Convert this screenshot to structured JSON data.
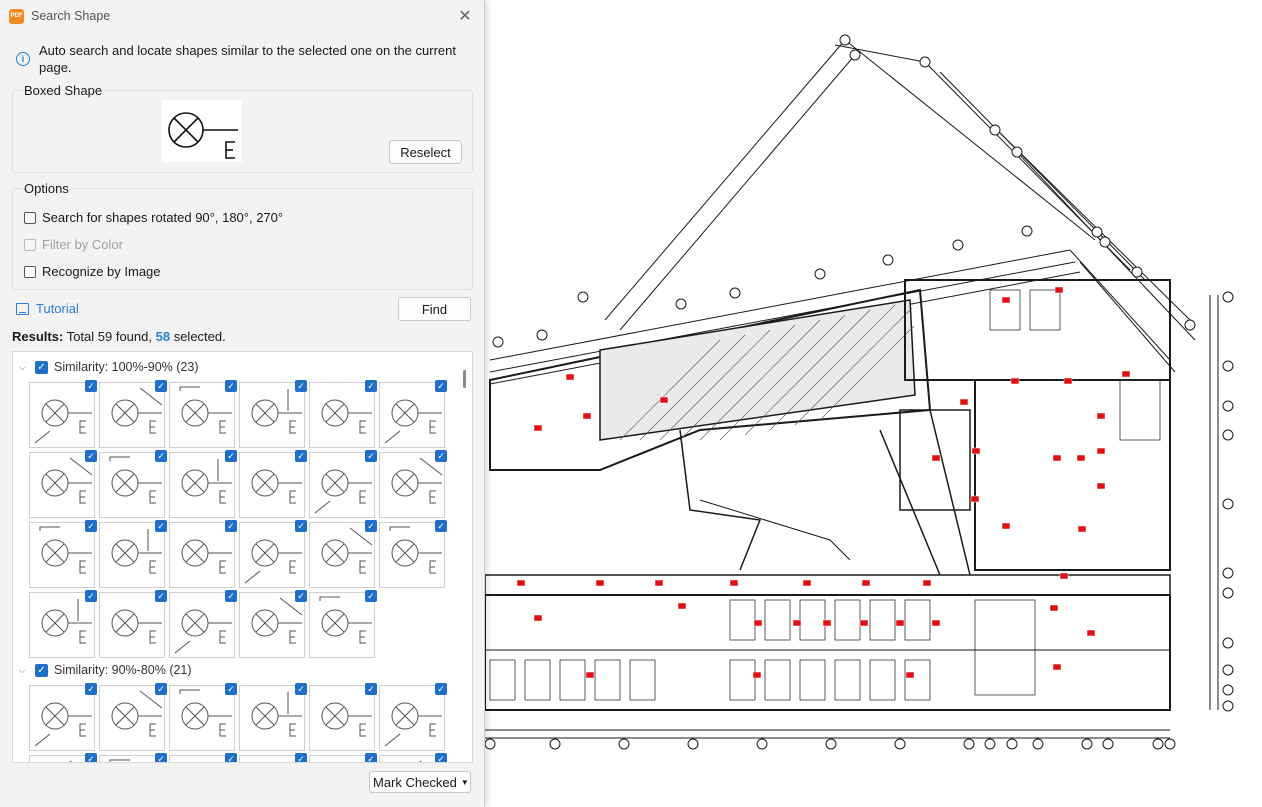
{
  "window": {
    "title": "Search Shape",
    "app_icon": "PDF",
    "close_glyph": "✕"
  },
  "info": {
    "text": "Auto search and locate shapes similar to the selected one on the current page.",
    "icon": "info-icon"
  },
  "boxed_shape": {
    "label": "Boxed Shape",
    "reselect_label": "Reselect"
  },
  "options": {
    "label": "Options",
    "items": [
      {
        "label": "Search for shapes rotated 90°, 180°, 270°",
        "checked": false,
        "disabled": false
      },
      {
        "label": "Filter by Color",
        "checked": false,
        "disabled": true
      },
      {
        "label": "Recognize by Image",
        "checked": false,
        "disabled": false
      }
    ]
  },
  "tutorial_label": "Tutorial",
  "find_label": "Find",
  "results": {
    "prefix": "Results:",
    "text_before": "Total 59 found,",
    "selected": "58",
    "text_after": "selected."
  },
  "groups": [
    {
      "label": "Similarity: 100%-90% (23)",
      "count": 23
    },
    {
      "label": "Similarity: 90%-80% (21)",
      "count": 21
    }
  ],
  "mark_checked_label": "Mark Checked",
  "colors": {
    "accent": "#1f6fc8",
    "link": "#2a7fd0",
    "marker": "#e01010",
    "app_icon": "#f08a24"
  }
}
